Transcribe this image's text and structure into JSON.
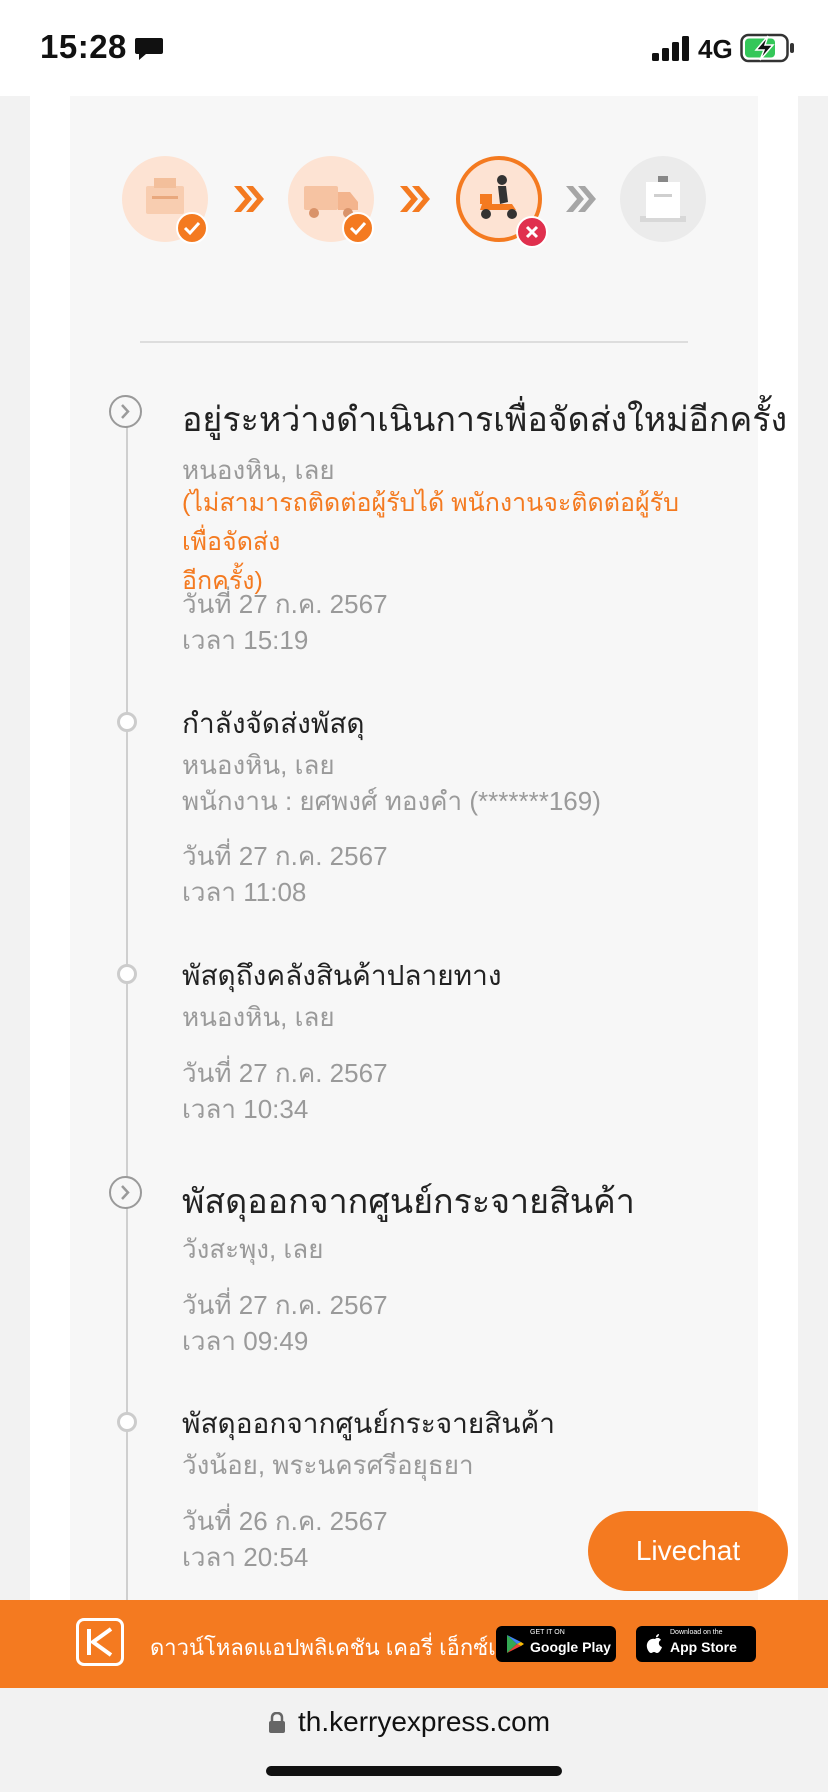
{
  "status_bar": {
    "time": "15:28",
    "network": "4G",
    "message_icon": "message-bubble-icon",
    "signal_icon": "signal-bars-icon",
    "battery_icon": "battery-charging-icon"
  },
  "progress_steps": [
    {
      "name": "picked-up",
      "icon": "parcel-icon",
      "state": "done"
    },
    {
      "name": "in-transit",
      "icon": "truck-icon",
      "state": "done"
    },
    {
      "name": "out-for-delivery",
      "icon": "scooter-rider-icon",
      "state": "failed"
    },
    {
      "name": "delivered",
      "icon": "delivered-box-icon",
      "state": "pending"
    }
  ],
  "colors": {
    "accent": "#f47a20",
    "error": "#e0304e",
    "muted_text": "#9a9a9a"
  },
  "events": [
    {
      "title": "อยู่ระหว่างดำเนินการเพื่อจัดส่งใหม่อีกครั้ง",
      "location": "หนองหิน, เลย",
      "note_line1": "(ไม่สามารถติดต่อผู้รับได้ พนักงานจะติดต่อผู้รับเพื่อจัดส่ง",
      "note_line2": "อีกครั้ง)",
      "date": "วันที่ 27 ก.ค. 2567",
      "time": "เวลา 15:19"
    },
    {
      "title": "กำลังจัดส่งพัสดุ",
      "location": "หนองหิน, เลย",
      "staff": "พนักงาน : ยศพงศ์ ทองคำ (*******169)",
      "date": "วันที่ 27 ก.ค. 2567",
      "time": "เวลา 11:08"
    },
    {
      "title": "พัสดุถึงคลังสินค้าปลายทาง",
      "location": "หนองหิน, เลย",
      "date": "วันที่ 27 ก.ค. 2567",
      "time": "เวลา 10:34"
    },
    {
      "title": "พัสดุออกจากศูนย์กระจายสินค้า",
      "location": "วังสะพุง, เลย",
      "date": "วันที่ 27 ก.ค. 2567",
      "time": "เวลา 09:49"
    },
    {
      "title": "พัสดุออกจากศูนย์กระจายสินค้า",
      "location": "วังน้อย, พระนครศรีอยุธยา",
      "date": "วันที่ 26 ก.ค. 2567",
      "time": "เวลา 20:54"
    }
  ],
  "livechat": {
    "label": "Livechat"
  },
  "app_banner": {
    "text": "ดาวน์โหลดแอปพลิเคชัน เคอรี่ เอ็กซ์เพรส",
    "google_small": "GET IT ON",
    "google_big": "Google Play",
    "apple_small": "Download on the",
    "apple_big": "App Store"
  },
  "url_bar": {
    "url": "th.kerryexpress.com"
  }
}
